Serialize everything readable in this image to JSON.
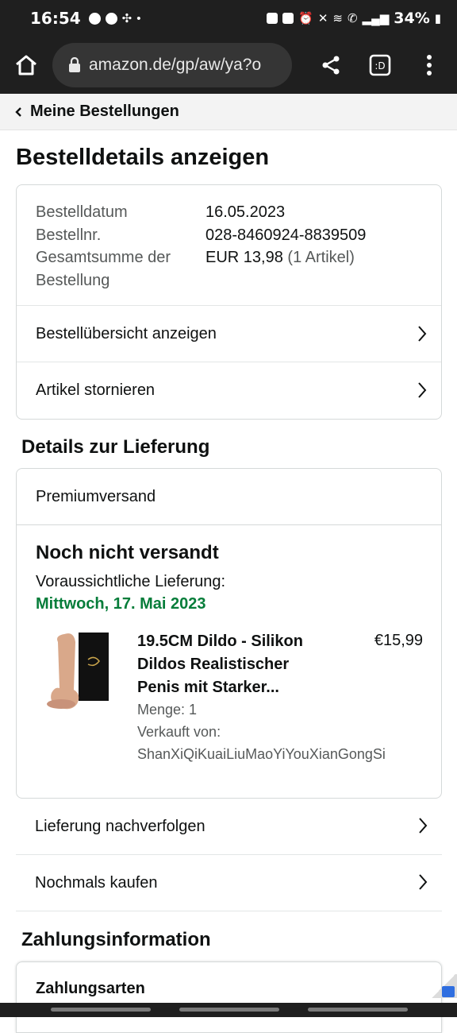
{
  "status_bar": {
    "time": "16:54",
    "battery": "34%",
    "left_icons": [
      "s-circle-icon",
      "shield-x-icon",
      "pinwheel-icon",
      "dot-icon"
    ],
    "right_icons": [
      "upload-icon",
      "recycle-icon",
      "alarm-icon",
      "mute-icon",
      "wifi-icon",
      "call-icon",
      "signal-icon",
      "battery-icon"
    ]
  },
  "browser": {
    "url": "amazon.de/gp/aw/ya?o"
  },
  "breadcrumb": {
    "label": "Meine Bestellungen"
  },
  "page": {
    "title": "Bestelldetails anzeigen"
  },
  "order_summary": {
    "rows": [
      {
        "label": "Bestelldatum",
        "value": "16.05.2023"
      },
      {
        "label": "Bestellnr.",
        "value": "028-8460924-8839509"
      },
      {
        "label": "Gesamtsumme der",
        "label2": "Bestellung",
        "value": "EUR 13,98",
        "value_muted": "(1 Artikel)"
      }
    ],
    "links": [
      {
        "label": "Bestellübersicht anzeigen"
      },
      {
        "label": "Artikel stornieren"
      }
    ]
  },
  "delivery": {
    "heading": "Details zur Lieferung",
    "ship_method": "Premiumversand",
    "status": "Noch nicht versandt",
    "eta_label": "Voraussichtliche Lieferung:",
    "eta_date": "Mittwoch, 17. Mai 2023",
    "product": {
      "title_lines": [
        "19.5CM Dildo - Silikon",
        "Dildos Realistischer",
        "Penis mit Starker..."
      ],
      "price": "€15,99",
      "quantity": "Menge: 1",
      "sold_by_label": "Verkauft von:",
      "seller": "ShanXiQiKuaiLiuMaoYiYouXianGongSi"
    },
    "links": [
      {
        "label": "Lieferung nachverfolgen"
      },
      {
        "label": "Nochmals kaufen"
      }
    ]
  },
  "payment": {
    "heading": "Zahlungsinformation",
    "methods_label": "Zahlungsarten"
  },
  "colors": {
    "status_bar_bg": "#1f1f1f",
    "eta_green": "#067d3a",
    "muted_text": "#565959",
    "card_border": "#d5d9d9"
  }
}
